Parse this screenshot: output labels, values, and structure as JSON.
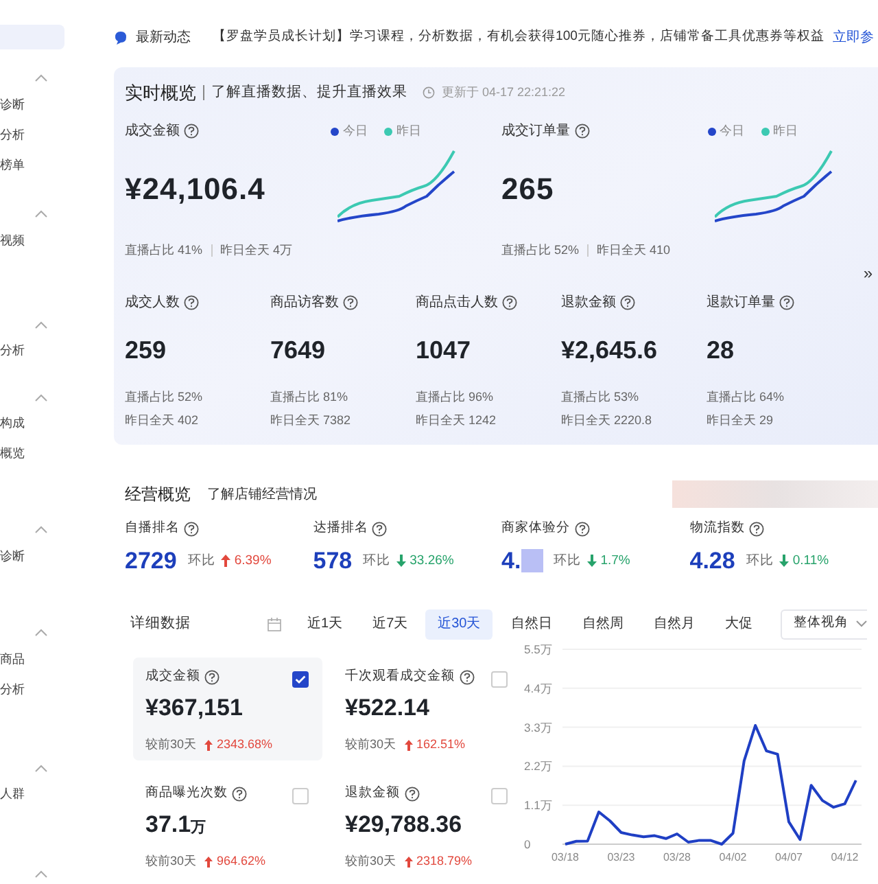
{
  "sidebar": {
    "top_item": {
      "selected": true
    },
    "sections": [
      {
        "expanded": true,
        "items": [
          "诊断",
          "分析",
          "榜单"
        ]
      },
      {
        "expanded": true,
        "items": [
          "视频"
        ]
      },
      {
        "expanded": true,
        "items": [
          "分析"
        ]
      },
      {
        "expanded": true,
        "items": [
          "构成",
          "概览"
        ]
      },
      {
        "expanded": true,
        "items": [
          "诊断"
        ]
      },
      {
        "expanded": true,
        "items": [
          "商品",
          "分析"
        ]
      },
      {
        "expanded": true,
        "items": [
          "人群"
        ]
      },
      {
        "expanded": true
      }
    ]
  },
  "notice": {
    "label": "最新动态",
    "text": "【罗盘学员成长计划】学习课程，分析数据，有机会获得100元随心推券，店铺常备工具优惠券等权益",
    "link": "立即参"
  },
  "realtime": {
    "title": "实时概览",
    "subtitle": "了解直播数据、提升直播效果",
    "updated": "更新于 04-17 22:21:22",
    "expand": "»",
    "main_metrics": [
      {
        "label": "成交金额",
        "value": "¥24,106.4",
        "live_share": "直播占比 41%",
        "yesterday": "昨日全天 4万",
        "legend": [
          {
            "label": "今日",
            "color": "#2446c9"
          },
          {
            "label": "昨日",
            "color": "#3cc9b2"
          }
        ]
      },
      {
        "label": "成交订单量",
        "value": "265",
        "live_share": "直播占比 52%",
        "yesterday": "昨日全天 410",
        "legend": [
          {
            "label": "今日",
            "color": "#2446c9"
          },
          {
            "label": "昨日",
            "color": "#3cc9b2"
          }
        ]
      }
    ],
    "metrics": [
      {
        "label": "成交人数",
        "value": "259",
        "live_share": "直播占比 52%",
        "yesterday": "昨日全天 402"
      },
      {
        "label": "商品访客数",
        "value": "7649",
        "live_share": "直播占比 81%",
        "yesterday": "昨日全天 7382"
      },
      {
        "label": "商品点击人数",
        "value": "1047",
        "live_share": "直播占比 96%",
        "yesterday": "昨日全天 1242"
      },
      {
        "label": "退款金额",
        "value": "¥2,645.6",
        "live_share": "直播占比 53%",
        "yesterday": "昨日全天 2220.8"
      },
      {
        "label": "退款订单量",
        "value": "28",
        "live_share": "直播占比 64%",
        "yesterday": "昨日全天 29"
      }
    ]
  },
  "business": {
    "title": "经营概览",
    "subtitle": "了解店铺经营情况",
    "metrics": [
      {
        "label": "自播排名",
        "value": "2729",
        "compare": "环比",
        "rising": true,
        "change": "6.39%"
      },
      {
        "label": "达播排名",
        "value": "578",
        "compare": "环比",
        "rising": false,
        "change": "33.26%"
      },
      {
        "label": "商家体验分",
        "value": "4.",
        "blurred": true,
        "compare": "环比",
        "rising": false,
        "change": "1.7%"
      },
      {
        "label": "物流指数",
        "value": "4.28",
        "compare": "环比",
        "rising": false,
        "change": "0.11%"
      }
    ]
  },
  "detail": {
    "title": "详细数据",
    "tabs": [
      {
        "label": "近1天",
        "selected": false
      },
      {
        "label": "近7天",
        "selected": false
      },
      {
        "label": "近30天",
        "selected": true
      },
      {
        "label": "自然日",
        "selected": false
      },
      {
        "label": "自然周",
        "selected": false
      },
      {
        "label": "自然月",
        "selected": false
      },
      {
        "label": "大促",
        "selected": false
      }
    ],
    "view_select": "整体视角",
    "cards": [
      {
        "label": "成交金额",
        "value": "¥367,151",
        "compare": "较前30天",
        "change": "2343.68%",
        "checked": true
      },
      {
        "label": "千次观看成交金额",
        "value": "¥522.14",
        "compare": "较前30天",
        "change": "162.51%",
        "checked": false
      },
      {
        "label": "商品曝光次数",
        "value": "37.1",
        "unit": "万",
        "compare": "较前30天",
        "change": "964.62%",
        "checked": false
      },
      {
        "label": "退款金额",
        "value": "¥29,788.36",
        "compare": "较前30天",
        "change": "2318.79%",
        "checked": false
      }
    ],
    "chart_data": {
      "type": "line",
      "categories": [
        "03/18",
        null,
        null,
        null,
        null,
        "03/23",
        null,
        null,
        null,
        null,
        "03/28",
        null,
        null,
        null,
        null,
        "04/02",
        null,
        null,
        null,
        null,
        "04/07",
        null,
        null,
        null,
        null,
        "04/12",
        null
      ],
      "grid": true,
      "series": [
        {
          "color": "#1f3fc4",
          "values": [
            0,
            0.08,
            0.09,
            0.91,
            0.66,
            0.33,
            0.26,
            0.21,
            0.24,
            0.16,
            0.29,
            0.06,
            0.11,
            0.11,
            0,
            0.31,
            2.35,
            3.35,
            2.63,
            2.54,
            0.63,
            0.13,
            1.66,
            1.23,
            1.04,
            1.14,
            1.8
          ]
        }
      ],
      "ylim": [
        0,
        5.5
      ],
      "yticks": [
        {
          "value": 0,
          "label": "0"
        },
        {
          "value": 1.1,
          "label": "1.1万"
        },
        {
          "value": 2.2,
          "label": "2.2万"
        },
        {
          "value": 3.3,
          "label": "3.3万"
        },
        {
          "value": 4.4,
          "label": "4.4万"
        },
        {
          "value": 5.5,
          "label": "5.5万"
        }
      ]
    }
  }
}
